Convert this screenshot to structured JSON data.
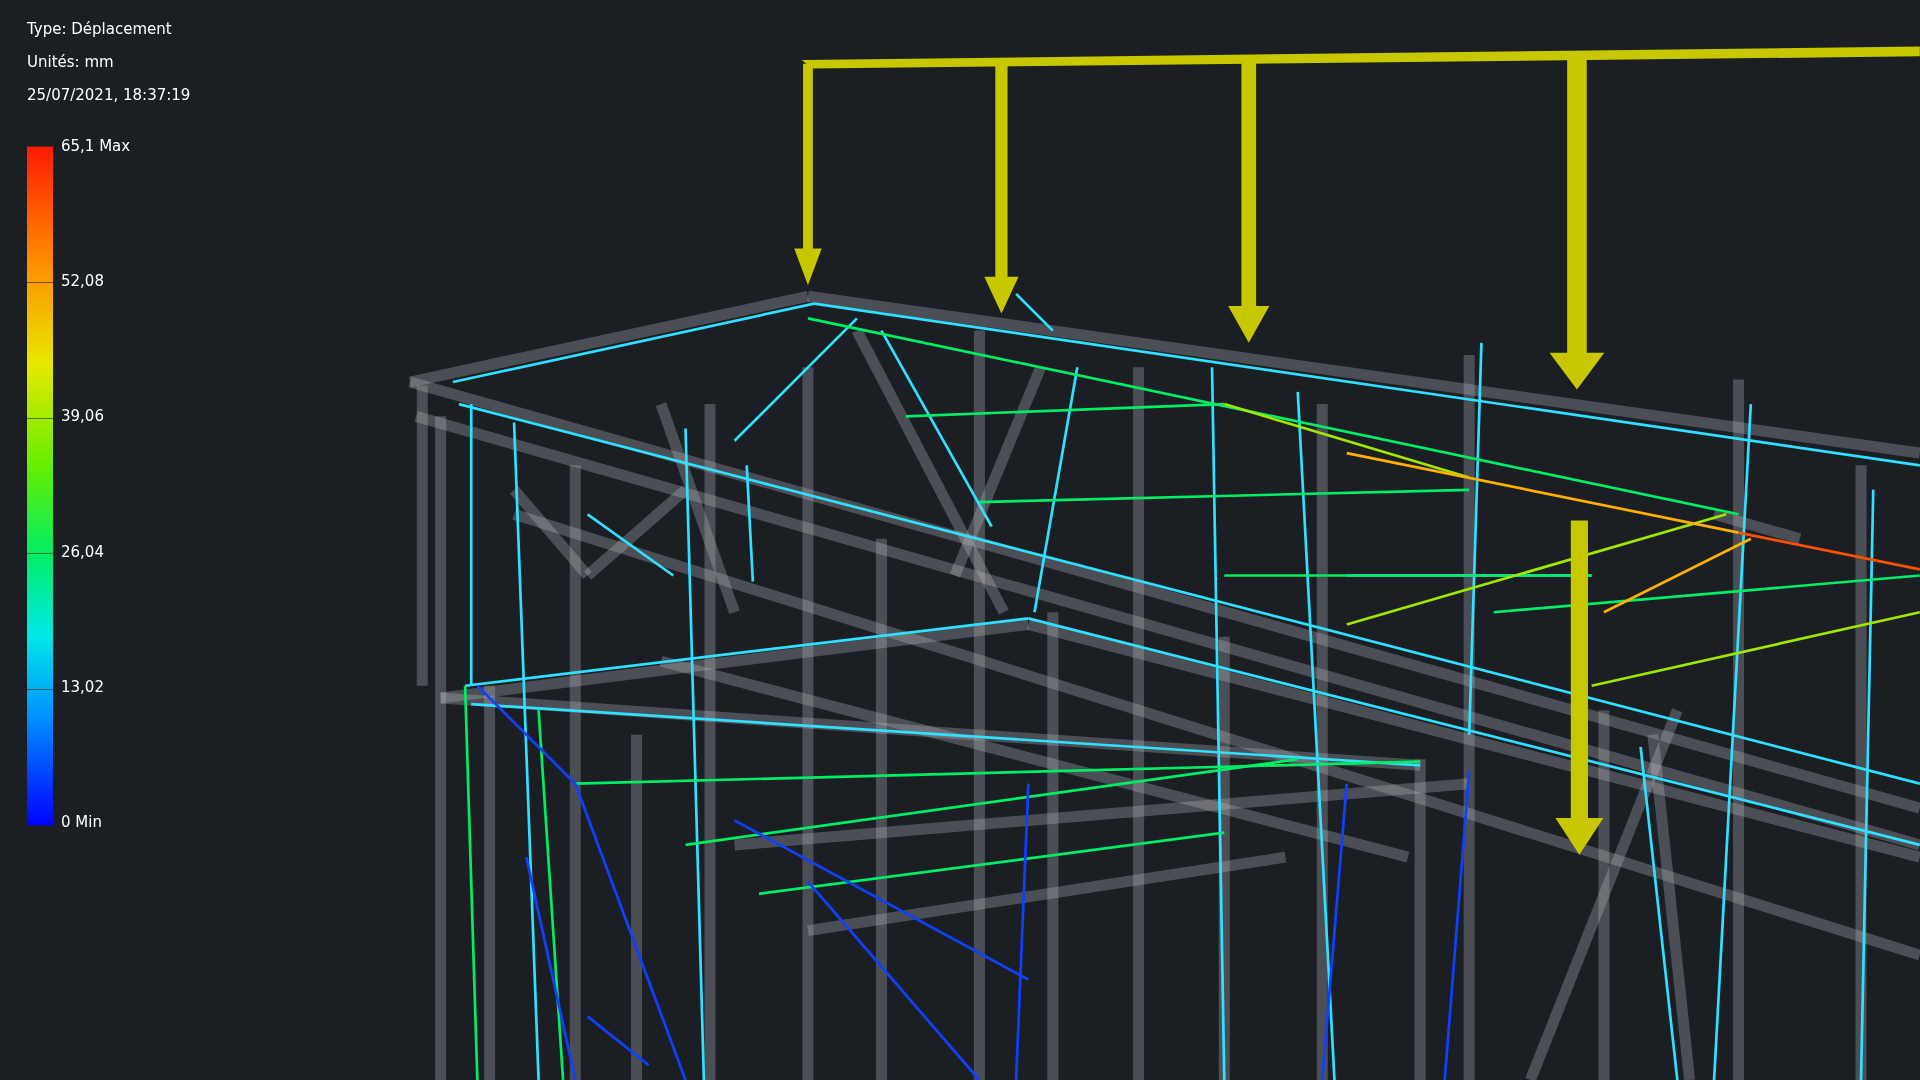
{
  "header": {
    "type_label": "Type: Déplacement",
    "units_label": "Unités: mm",
    "timestamp": "25/07/2021, 18:37:19"
  },
  "legend": {
    "labels": [
      "65,1 Max",
      "52,08",
      "39,06",
      "26,04",
      "13,02",
      "0 Min"
    ]
  }
}
